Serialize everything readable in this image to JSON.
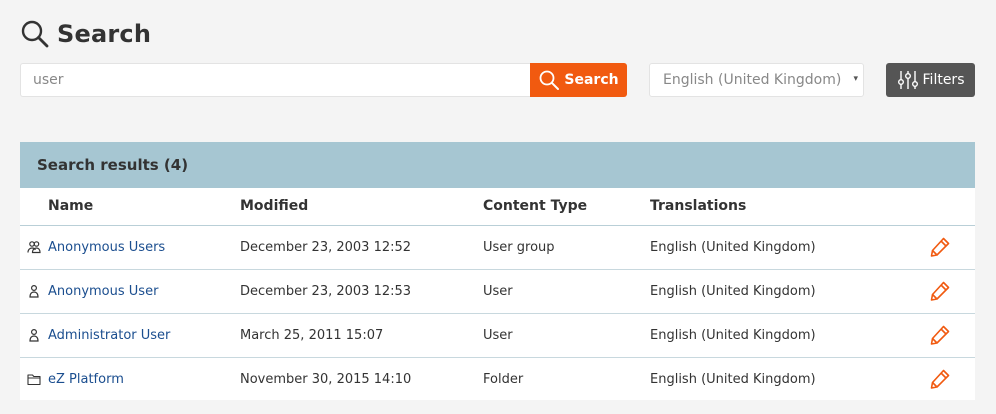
{
  "page": {
    "title": "Search",
    "title_icon": "search-icon"
  },
  "search": {
    "value": "",
    "placeholder": "user",
    "button_label": "Search",
    "button_icon": "search-icon",
    "button_color": "#f15a10"
  },
  "language_select": {
    "selected": "English (United Kingdom)",
    "caret": "▾"
  },
  "filters": {
    "label": "Filters",
    "icon": "sliders-icon"
  },
  "results": {
    "title": "Search results (4)",
    "header_color": "#a6c6d2",
    "columns": [
      "Name",
      "Modified",
      "Content Type",
      "Translations"
    ],
    "rows": [
      {
        "icon": "user-group-icon",
        "name": "Anonymous Users",
        "modified": "December 23, 2003 12:52",
        "content_type": "User group",
        "translations": "English (United Kingdom)",
        "edit_icon": "pencil-icon"
      },
      {
        "icon": "user-icon",
        "name": "Anonymous User",
        "modified": "December 23, 2003 12:53",
        "content_type": "User",
        "translations": "English (United Kingdom)",
        "edit_icon": "pencil-icon"
      },
      {
        "icon": "user-icon",
        "name": "Administrator User",
        "modified": "March 25, 2011 15:07",
        "content_type": "User",
        "translations": "English (United Kingdom)",
        "edit_icon": "pencil-icon"
      },
      {
        "icon": "folder-icon",
        "name": "eZ Platform",
        "modified": "November 30, 2015 14:10",
        "content_type": "Folder",
        "translations": "English (United Kingdom)",
        "edit_icon": "pencil-icon"
      }
    ]
  }
}
